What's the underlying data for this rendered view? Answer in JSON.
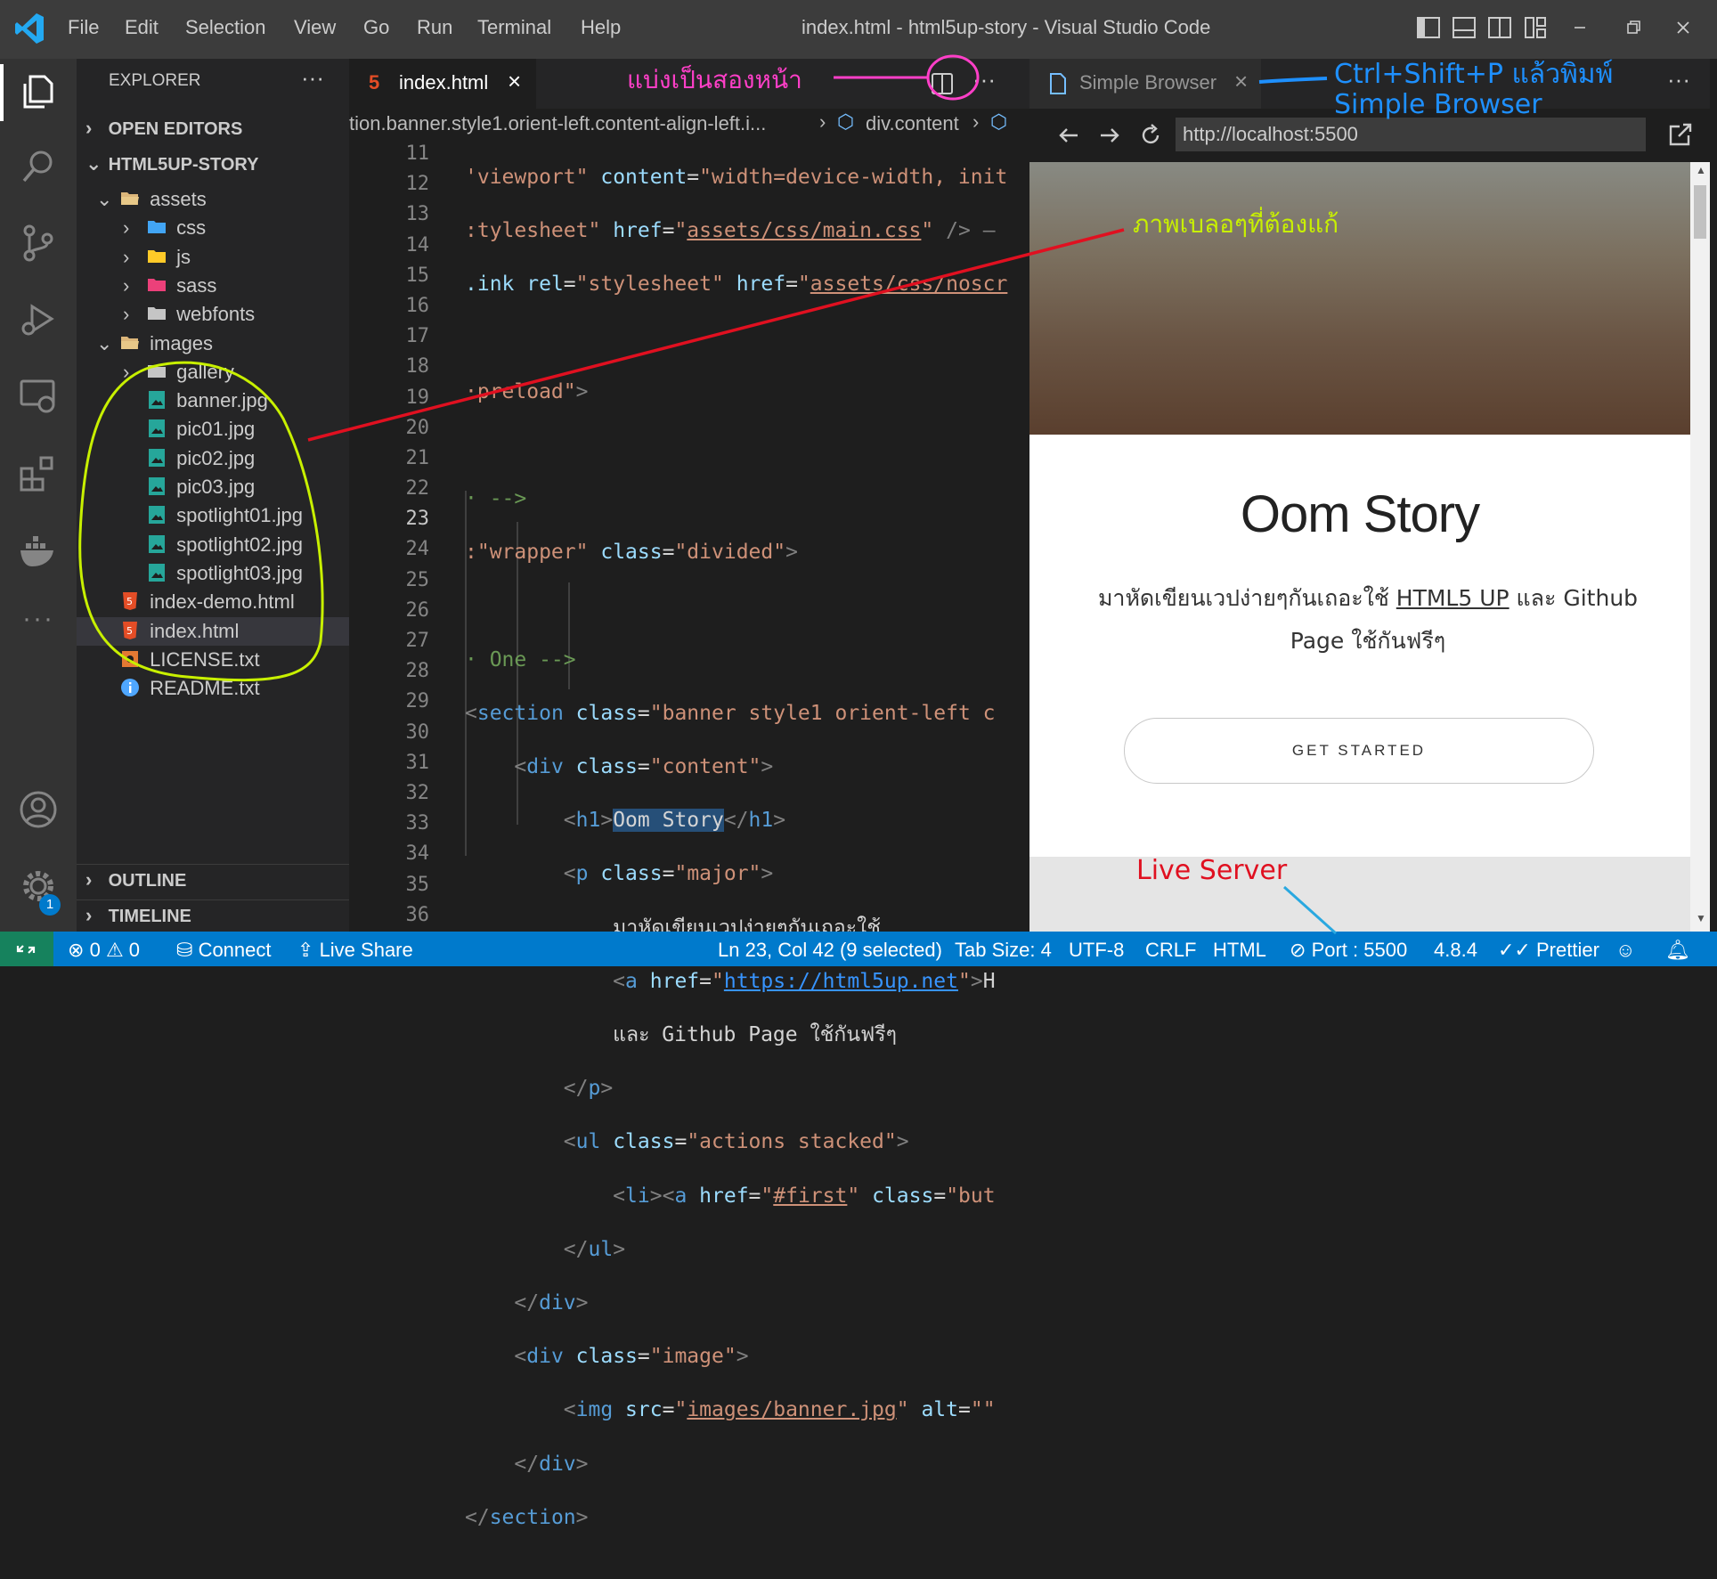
{
  "titlebar": {
    "menu": [
      "File",
      "Edit",
      "Selection",
      "View",
      "Go",
      "Run",
      "Terminal",
      "Help"
    ],
    "window_title": "index.html - html5up-story - Visual Studio Code"
  },
  "sidebar": {
    "title": "EXPLORER",
    "more": "···",
    "open_editors": "OPEN EDITORS",
    "project": "HTML5UP-STORY",
    "tree": [
      {
        "label": "assets",
        "type": "folder-open",
        "depth": 1
      },
      {
        "label": "css",
        "type": "folder",
        "depth": 2
      },
      {
        "label": "js",
        "type": "folder",
        "depth": 2
      },
      {
        "label": "sass",
        "type": "folder",
        "depth": 2
      },
      {
        "label": "webfonts",
        "type": "folder",
        "depth": 2
      },
      {
        "label": "images",
        "type": "folder-open",
        "depth": 1
      },
      {
        "label": "gallery",
        "type": "folder",
        "depth": 2
      },
      {
        "label": "banner.jpg",
        "type": "image",
        "depth": 2
      },
      {
        "label": "pic01.jpg",
        "type": "image",
        "depth": 2
      },
      {
        "label": "pic02.jpg",
        "type": "image",
        "depth": 2
      },
      {
        "label": "pic03.jpg",
        "type": "image",
        "depth": 2
      },
      {
        "label": "spotlight01.jpg",
        "type": "image",
        "depth": 2
      },
      {
        "label": "spotlight02.jpg",
        "type": "image",
        "depth": 2
      },
      {
        "label": "spotlight03.jpg",
        "type": "image",
        "depth": 2
      },
      {
        "label": "index-demo.html",
        "type": "html",
        "depth": 1
      },
      {
        "label": "index.html",
        "type": "html",
        "depth": 1
      },
      {
        "label": "LICENSE.txt",
        "type": "license",
        "depth": 1
      },
      {
        "label": "README.txt",
        "type": "info",
        "depth": 1
      }
    ],
    "outline": "OUTLINE",
    "timeline": "TIMELINE"
  },
  "editor": {
    "tab_label": "index.html",
    "breadcrumb_section": "tion.banner.style1.orient-left.content-align-left.i...",
    "breadcrumb_div": "div.content",
    "line_numbers": [
      "11",
      "12",
      "13",
      "14",
      "15",
      "16",
      "17",
      "18",
      "19",
      "20",
      "21",
      "22",
      "23",
      "24",
      "25",
      "26",
      "27",
      "28",
      "29",
      "30",
      "31",
      "32",
      "33",
      "34",
      "35",
      "36"
    ],
    "current_line": "23"
  },
  "browser": {
    "tab_label": "Simple Browser",
    "url": "http://localhost:5500",
    "page": {
      "heading": "Oom Story",
      "desc_thai": "มาหัดเขียนเวปง่ายๆกันเถอะใช้ ",
      "desc_link": "HTML5 UP",
      "desc_and": " และ ",
      "desc_github": "Github",
      "desc_page": "Page",
      "desc_free": " ใช้กันฟรีๆ",
      "button": "GET STARTED"
    }
  },
  "statusbar": {
    "errors": "0",
    "warnings": "0",
    "connect": "Connect",
    "live_share": "Live Share",
    "cursor": "Ln 23, Col 42 (9 selected)",
    "tab_size": "Tab Size: 4",
    "encoding": "UTF-8",
    "eol": "CRLF",
    "language": "HTML",
    "port": "Port : 5500",
    "version": "4.8.4",
    "prettier": "Prettier",
    "settings_badge": "1"
  },
  "annotations": {
    "split": "แบ่งเป็นสองหน้า",
    "cmd_line1": "Ctrl+Shift+P แล้วพิมพ์",
    "cmd_line2": "Simple Browser",
    "blur": "ภาพเบลอๆที่ต้องแก้",
    "live_server": "Live Server"
  },
  "colors": {
    "accent": "#007acc",
    "annotation_pink": "#ff3fc8",
    "annotation_blue": "#1e90ff",
    "annotation_lime": "#c8f000",
    "annotation_red": "#e01020"
  }
}
